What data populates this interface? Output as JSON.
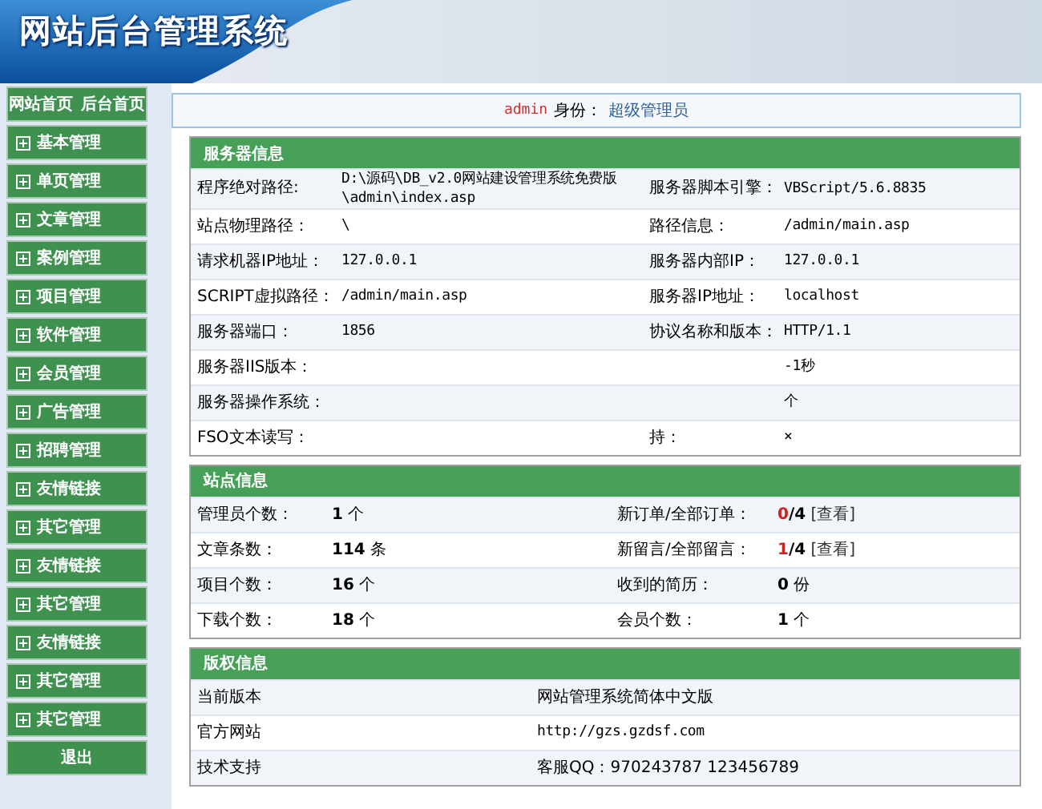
{
  "header": {
    "logo": "网站后台管理系统"
  },
  "sidebar": {
    "top_links": [
      {
        "label": "网站首页"
      },
      {
        "label": "后台首页"
      }
    ],
    "items": [
      {
        "label": "基本管理"
      },
      {
        "label": "单页管理"
      },
      {
        "label": "文章管理"
      },
      {
        "label": "案例管理"
      },
      {
        "label": "项目管理"
      },
      {
        "label": "软件管理"
      },
      {
        "label": "会员管理"
      },
      {
        "label": "广告管理"
      },
      {
        "label": "招聘管理"
      },
      {
        "label": "友情链接"
      },
      {
        "label": "其它管理"
      },
      {
        "label": "友情链接"
      },
      {
        "label": "其它管理"
      },
      {
        "label": "友情链接"
      },
      {
        "label": "其它管理"
      },
      {
        "label": "其它管理"
      }
    ],
    "logout": "退出"
  },
  "user_bar": {
    "user": "admin",
    "role_label": "身份：",
    "role": "超级管理员"
  },
  "server_panel": {
    "title": "服务器信息",
    "rows": [
      {
        "label_1": "程序绝对路径:",
        "value_1": "D:\\源码\\DB_v2.0网站建设管理系统免费版\n\\admin\\index.asp",
        "label_2": "服务器脚本引擎：",
        "value_2": "VBScript/5.6.8835"
      },
      {
        "label_1": "站点物理路径：",
        "value_1": "\\",
        "label_2": "路径信息：",
        "value_2": "/admin/main.asp"
      },
      {
        "label_1": "请求机器IP地址：",
        "value_1": "127.0.0.1",
        "label_2": "服务器内部IP：",
        "value_2": "127.0.0.1"
      },
      {
        "label_1": "SCRIPT虚拟路径：",
        "value_1": "/admin/main.asp",
        "label_2": "服务器IP地址：",
        "value_2": "localhost"
      },
      {
        "label_1": "服务器端口：",
        "value_1": "1856",
        "label_2": "协议名称和版本：",
        "value_2": "HTTP/1.1"
      },
      {
        "label_1": "服务器IIS版本：",
        "value_2": "-1秒"
      },
      {
        "label_1": "服务器操作系统：",
        "value_2": "个"
      },
      {
        "label_1": "FSO文本读写：",
        "label_2": "持：",
        "value_2": "×"
      }
    ]
  },
  "site_panel": {
    "title": "站点信息",
    "rows": [
      {
        "label_1": "管理员个数：",
        "count_1": "1",
        "unit_1": "个",
        "label_2": "新订单/全部订单：",
        "new_2": "0",
        "total_2": "/4",
        "link_2": "[查看]"
      },
      {
        "label_1": "文章条数：",
        "count_1": "114",
        "unit_1": "条",
        "label_2": "新留言/全部留言：",
        "new_2": "1",
        "total_2": "/4",
        "link_2": "[查看]"
      },
      {
        "label_1": "项目个数：",
        "count_1": "16",
        "unit_1": "个",
        "label_2": "收到的简历：",
        "count_2": "0",
        "unit_2": "份"
      },
      {
        "label_1": "下载个数：",
        "count_1": "18",
        "unit_1": "个",
        "label_2": "会员个数：",
        "count_2": "1",
        "unit_2": "个"
      }
    ]
  },
  "copyright_panel": {
    "title": "版权信息",
    "rows": [
      {
        "label": "当前版本",
        "value": "网站管理系统简体中文版"
      },
      {
        "label": "官方网站",
        "value": "http://gzs.gzdsf.com"
      },
      {
        "label": "技术支持",
        "value": "客服QQ：970243787 123456789"
      }
    ]
  }
}
